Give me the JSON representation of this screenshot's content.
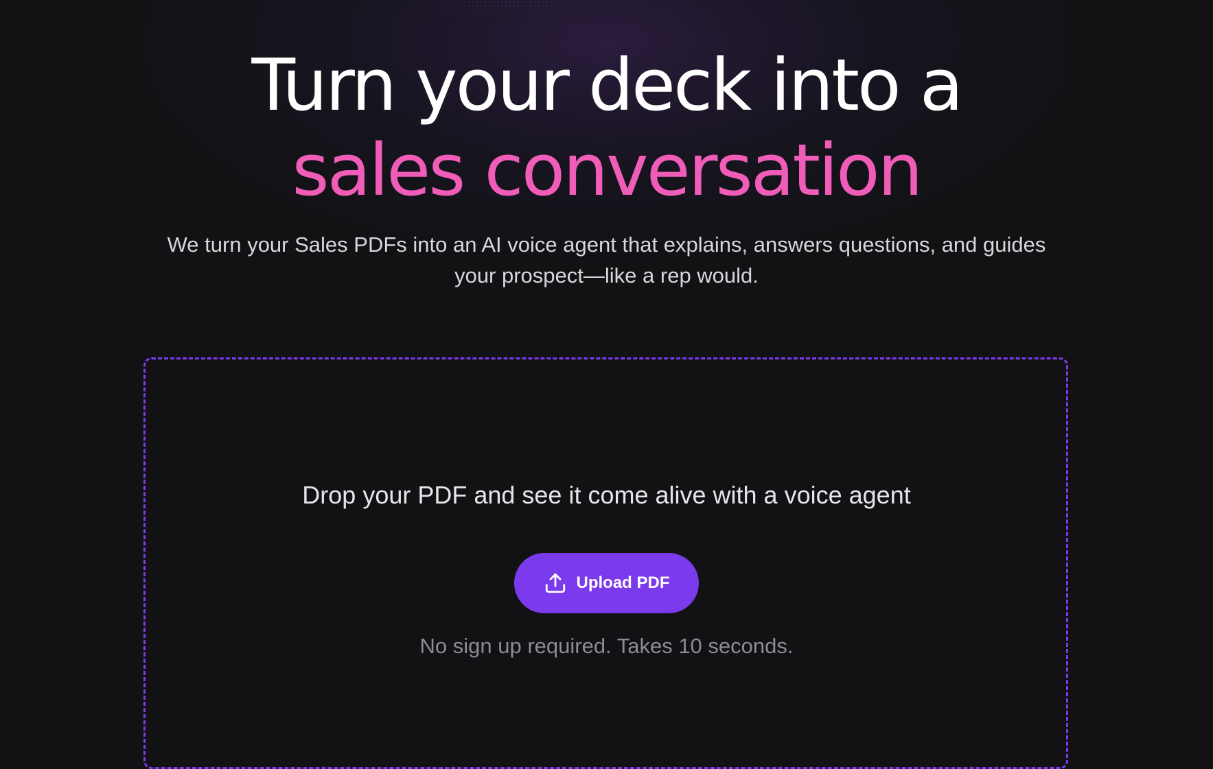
{
  "hero": {
    "headline_line1": "Turn your deck into a",
    "headline_line2": "sales conversation",
    "subtitle": "We turn your Sales PDFs into an AI voice agent that explains, answers questions, and guides your prospect—like a rep would."
  },
  "dropzone": {
    "title": "Drop your PDF and see it come alive with a voice agent",
    "upload_label": "Upload PDF",
    "upload_icon": "upload-icon",
    "note": "No sign up required. Takes 10 seconds."
  },
  "colors": {
    "background": "#121214",
    "accent_pink": "#f05db8",
    "accent_purple": "#7c3aed",
    "text_primary": "#ffffff",
    "text_secondary": "#d8d8dc",
    "text_muted": "#8c8c94"
  }
}
